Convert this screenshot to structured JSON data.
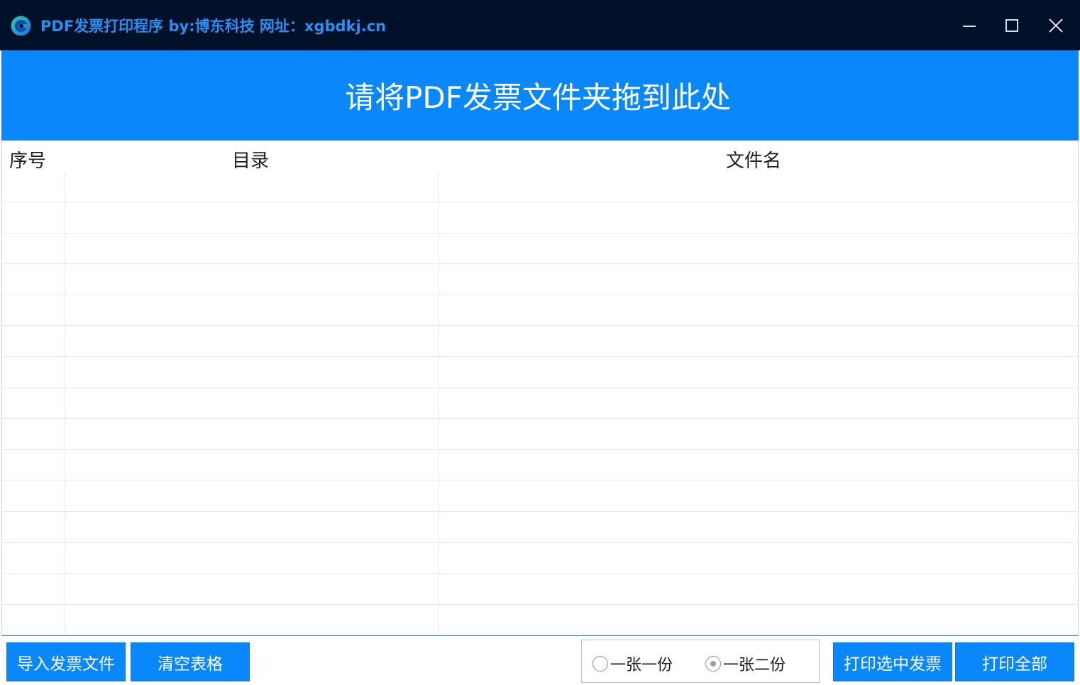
{
  "window": {
    "title": "PDF发票打印程序 by:博东科技 网址：xgbdkj.cn",
    "controls": {
      "minimize_icon": "minimize-icon",
      "maximize_icon": "maximize-icon",
      "close_icon": "close-icon"
    }
  },
  "dropzone": {
    "text": "请将PDF发票文件夹拖到此处"
  },
  "table": {
    "columns": [
      "序号",
      "目录",
      "文件名"
    ],
    "rows": []
  },
  "buttons": {
    "import": "导入发票文件",
    "clear": "清空表格",
    "print_selected": "打印选中发票",
    "print_all": "打印全部"
  },
  "copies": {
    "options": [
      "一张一份",
      "一张二份"
    ],
    "selected": "一张二份"
  },
  "colors": {
    "titlebar": "#011129",
    "title_text": "#2a8ff0",
    "accent": "#0a87fb"
  }
}
